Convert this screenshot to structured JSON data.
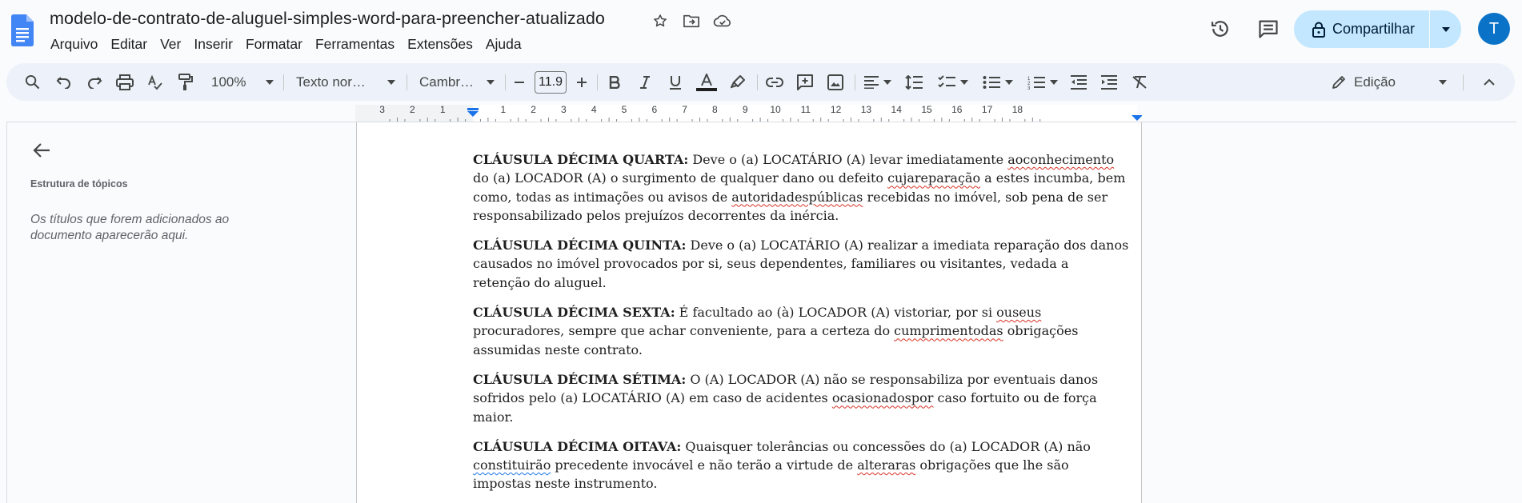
{
  "document": {
    "title": "modelo-de-contrato-de-aluguel-simples-word-para-preencher-atualizado"
  },
  "menu": [
    "Arquivo",
    "Editar",
    "Ver",
    "Inserir",
    "Formatar",
    "Ferramentas",
    "Extensões",
    "Ajuda"
  ],
  "header_icons": [
    "star-icon",
    "move-to-folder-icon",
    "cloud-status-icon",
    "version-history-icon",
    "comments-icon"
  ],
  "share": {
    "label": "Compartilhar"
  },
  "user": {
    "avatar_letter": "T",
    "avatar_color": "#0b73c7"
  },
  "toolbar": {
    "zoom": "100%",
    "style": "Texto nor…",
    "font": "Cambr…",
    "font_size": "11.9",
    "mode": "Edição",
    "text_color": "#1f1f1f"
  },
  "ruler": {
    "labels": [
      "3",
      "2",
      "1",
      "1",
      "2",
      "3",
      "4",
      "5",
      "6",
      "7",
      "8",
      "9",
      "10",
      "11",
      "12",
      "13",
      "14",
      "15",
      "16",
      "17",
      "18"
    ]
  },
  "outline": {
    "title": "Estrutura de tópicos",
    "empty_message": "Os títulos que forem adicionados ao documento aparecerão aqui."
  },
  "clauses": [
    {
      "heading": "CLÁUSULA DÉCIMA QUARTA:",
      "segments": [
        {
          "t": " Deve o (a) LOCATÁRIO (A) levar imediatamente "
        },
        {
          "t": "aoconhecimento",
          "spell": true
        },
        {
          "t": " do (a) LOCADOR (A) o surgimento de qualquer dano ou defeito "
        },
        {
          "t": "cujareparação",
          "spell": true
        },
        {
          "t": " a estes incumba, bem como, todas as intimações ou avisos de "
        },
        {
          "t": "autoridadespúblicas",
          "spell": true
        },
        {
          "t": " recebidas no imóvel, sob pena de ser responsabilizado pelos prejuízos decorrentes da inércia."
        }
      ]
    },
    {
      "heading": "CLÁUSULA DÉCIMA QUINTA:",
      "segments": [
        {
          "t": " Deve o (a) LOCATÁRIO (A) realizar a imediata reparação dos danos causados no imóvel provocados por si, seus dependentes, familiares ou visitantes, vedada a retenção do aluguel."
        }
      ]
    },
    {
      "heading": "CLÁUSULA DÉCIMA SEXTA:",
      "segments": [
        {
          "t": " É facultado ao (à) LOCADOR (A) vistoriar, por si "
        },
        {
          "t": "ouseus",
          "spell": true
        },
        {
          "t": " procuradores, sempre que achar conveniente, para a certeza do "
        },
        {
          "t": "cumprimentodas",
          "spell": true
        },
        {
          "t": " obrigações assumidas neste contrato."
        }
      ]
    },
    {
      "heading": "CLÁUSULA DÉCIMA SÉTIMA:",
      "segments": [
        {
          "t": " O (A) LOCADOR (A) não se responsabiliza por eventuais danos sofridos pelo (a) LOCATÁRIO (A) em caso de acidentes "
        },
        {
          "t": "ocasionadospor",
          "spell": true
        },
        {
          "t": " caso fortuito ou de força maior."
        }
      ]
    },
    {
      "heading": "CLÁUSULA DÉCIMA OITAVA:",
      "segments": [
        {
          "t": " Quaisquer tolerâncias ou concessões do (a) LOCADOR (A) não "
        },
        {
          "t": "constituirão",
          "grammar": true
        },
        {
          "t": " precedente invocável e não terão a virtude de "
        },
        {
          "t": "alteraras",
          "spell": true
        },
        {
          "t": " obrigações que lhe são impostas neste instrumento."
        }
      ]
    }
  ]
}
